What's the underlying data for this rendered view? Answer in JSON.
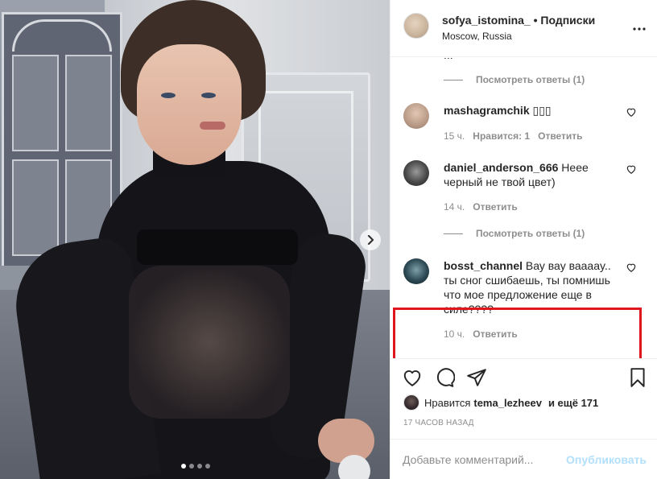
{
  "post": {
    "carousel_dots": 4,
    "active_dot": 0,
    "next_arrow": "chevron-right-icon"
  },
  "header": {
    "username": "sofya_istomina_",
    "separator": "•",
    "follow_label": "Подписки",
    "location": "Moscow, Russia",
    "more_icon": "more-horizontal-icon"
  },
  "comments": {
    "cut_text": "...",
    "view_replies_1": "Посмотреть ответы (1)",
    "view_replies_2": "Посмотреть ответы (1)",
    "items": [
      {
        "username": "mashagramchik",
        "text": "▯▯▯",
        "time": "15 ч.",
        "likes": "Нравится: 1",
        "reply": "Ответить"
      },
      {
        "username": "daniel_anderson_666",
        "text": "Неее черный не твой цвет)",
        "time": "14 ч.",
        "reply": "Ответить"
      },
      {
        "username": "bosst_channel",
        "text": "Вау вау вааааy.. ты сног сшибаешь, ты помнишь что мое предложение еще в силе????",
        "time": "10 ч.",
        "reply": "Ответить"
      }
    ]
  },
  "actions": {
    "like_icon": "heart-icon",
    "comment_icon": "comment-icon",
    "share_icon": "share-icon",
    "save_icon": "bookmark-icon"
  },
  "likes": {
    "prefix": "Нравится",
    "user": "tema_lezheev",
    "suffix": "и ещё 171"
  },
  "time_ago": "17 ЧАСОВ НАЗАД",
  "add_comment": {
    "placeholder": "Добавьте комментарий...",
    "publish_label": "Опубликовать"
  },
  "colors": {
    "highlight": "#e0161e",
    "publish_disabled": "#b2dffc",
    "muted_text": "#8e8e8e"
  }
}
